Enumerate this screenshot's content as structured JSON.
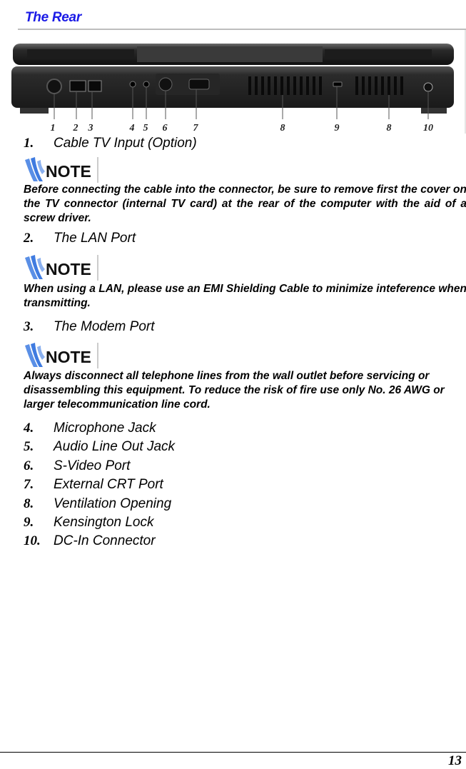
{
  "section": {
    "title": "The Rear"
  },
  "figure": {
    "description": "laptop-rear-view",
    "callouts": [
      "1",
      "2",
      "3",
      "4",
      "5",
      "6",
      "7",
      "8",
      "9",
      "8",
      "10"
    ]
  },
  "items": [
    {
      "num": "1.",
      "label": "Cable TV Input (Option)"
    },
    {
      "num": "2.",
      "label": "The LAN Port"
    },
    {
      "num": "3.",
      "label": "The Modem Port"
    },
    {
      "num": "4.",
      "label": "Microphone Jack"
    },
    {
      "num": "5.",
      "label": "Audio Line Out Jack"
    },
    {
      "num": "6.",
      "label": "S-Video Port"
    },
    {
      "num": "7.",
      "label": "External CRT Port"
    },
    {
      "num": "8.",
      "label": "Ventilation Opening"
    },
    {
      "num": "9.",
      "label": "Kensington Lock"
    },
    {
      "num": "10.",
      "label": "DC-In Connector"
    }
  ],
  "notes": [
    {
      "icon_label": "NOTE",
      "text": "Before connecting the cable into the connector, be sure to remove first the cover on the TV connector  (internal TV card) at the rear of the computer with the aid of a screw driver."
    },
    {
      "icon_label": "NOTE",
      "text": "When using a LAN, please use an EMI Shielding Cable to minimize inteference when transmitting."
    },
    {
      "icon_label": "NOTE",
      "text": "Always disconnect all telephone lines from the wall outlet before servicing or disassembling this equipment. To reduce the risk of fire use only No. 26 AWG or larger telecommunication line cord."
    }
  ],
  "colors": {
    "title": "#1a1ae6",
    "note_icon": "#4a86e8"
  },
  "footer": {
    "page_number": "13"
  }
}
